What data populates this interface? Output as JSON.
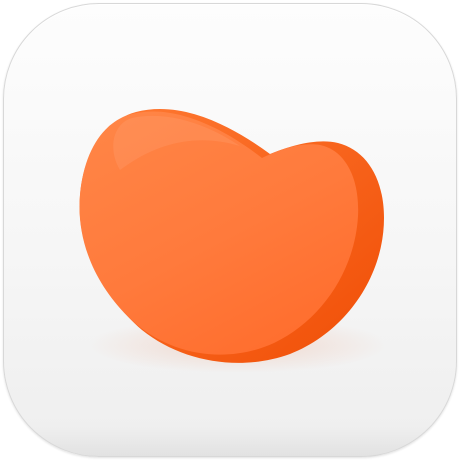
{
  "app_icon": {
    "icon": "orange-bean-logo-icon",
    "colors": {
      "tile_background": "#f4f4f4",
      "tile_border": "#d8d8d8",
      "logo_primary": "#ff7a3d",
      "logo_highlight": "#ff8a4c",
      "logo_shadow": "#fb5a10"
    }
  }
}
